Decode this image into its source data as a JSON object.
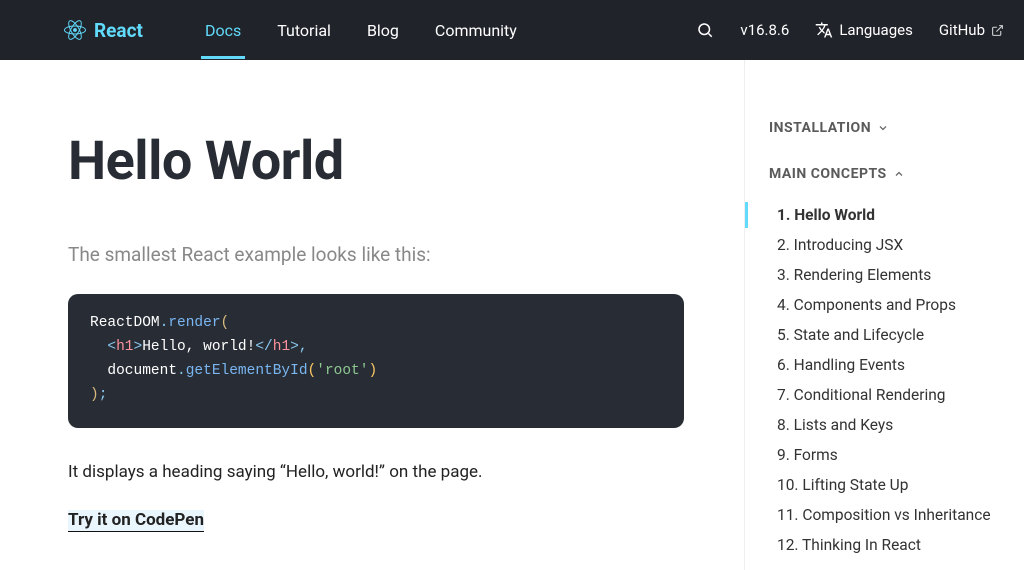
{
  "header": {
    "brand": "React",
    "nav": [
      "Docs",
      "Tutorial",
      "Blog",
      "Community"
    ],
    "activeIndex": 0,
    "version": "v16.8.6",
    "languages": "Languages",
    "github": "GitHub"
  },
  "main": {
    "title": "Hello World",
    "subtitle": "The smallest React example looks like this:",
    "body": "It displays a heading saying “Hello, world!” on the page.",
    "tryLink": "Try it on CodePen"
  },
  "code": {
    "l1a": "ReactDOM",
    "l1b": ".",
    "l1c": "render",
    "l1d": "(",
    "l2a": "  ",
    "l2b": "<",
    "l2c": "h1",
    "l2d": ">",
    "l2e": "Hello, world!",
    "l2f": "</",
    "l2g": "h1",
    "l2h": ">",
    "l2i": ",",
    "l3a": "  document",
    "l3b": ".",
    "l3c": "getElementById",
    "l3d": "(",
    "l3e": "'root'",
    "l3f": ")",
    "l4a": ")",
    "l4b": ";"
  },
  "sidebar": {
    "sec1": "Installation",
    "sec2": "Main Concepts",
    "items": [
      "1. Hello World",
      "2. Introducing JSX",
      "3. Rendering Elements",
      "4. Components and Props",
      "5. State and Lifecycle",
      "6. Handling Events",
      "7. Conditional Rendering",
      "8. Lists and Keys",
      "9. Forms",
      "10. Lifting State Up",
      "11. Composition vs Inheritance",
      "12. Thinking In React"
    ],
    "activeIndex": 0
  }
}
